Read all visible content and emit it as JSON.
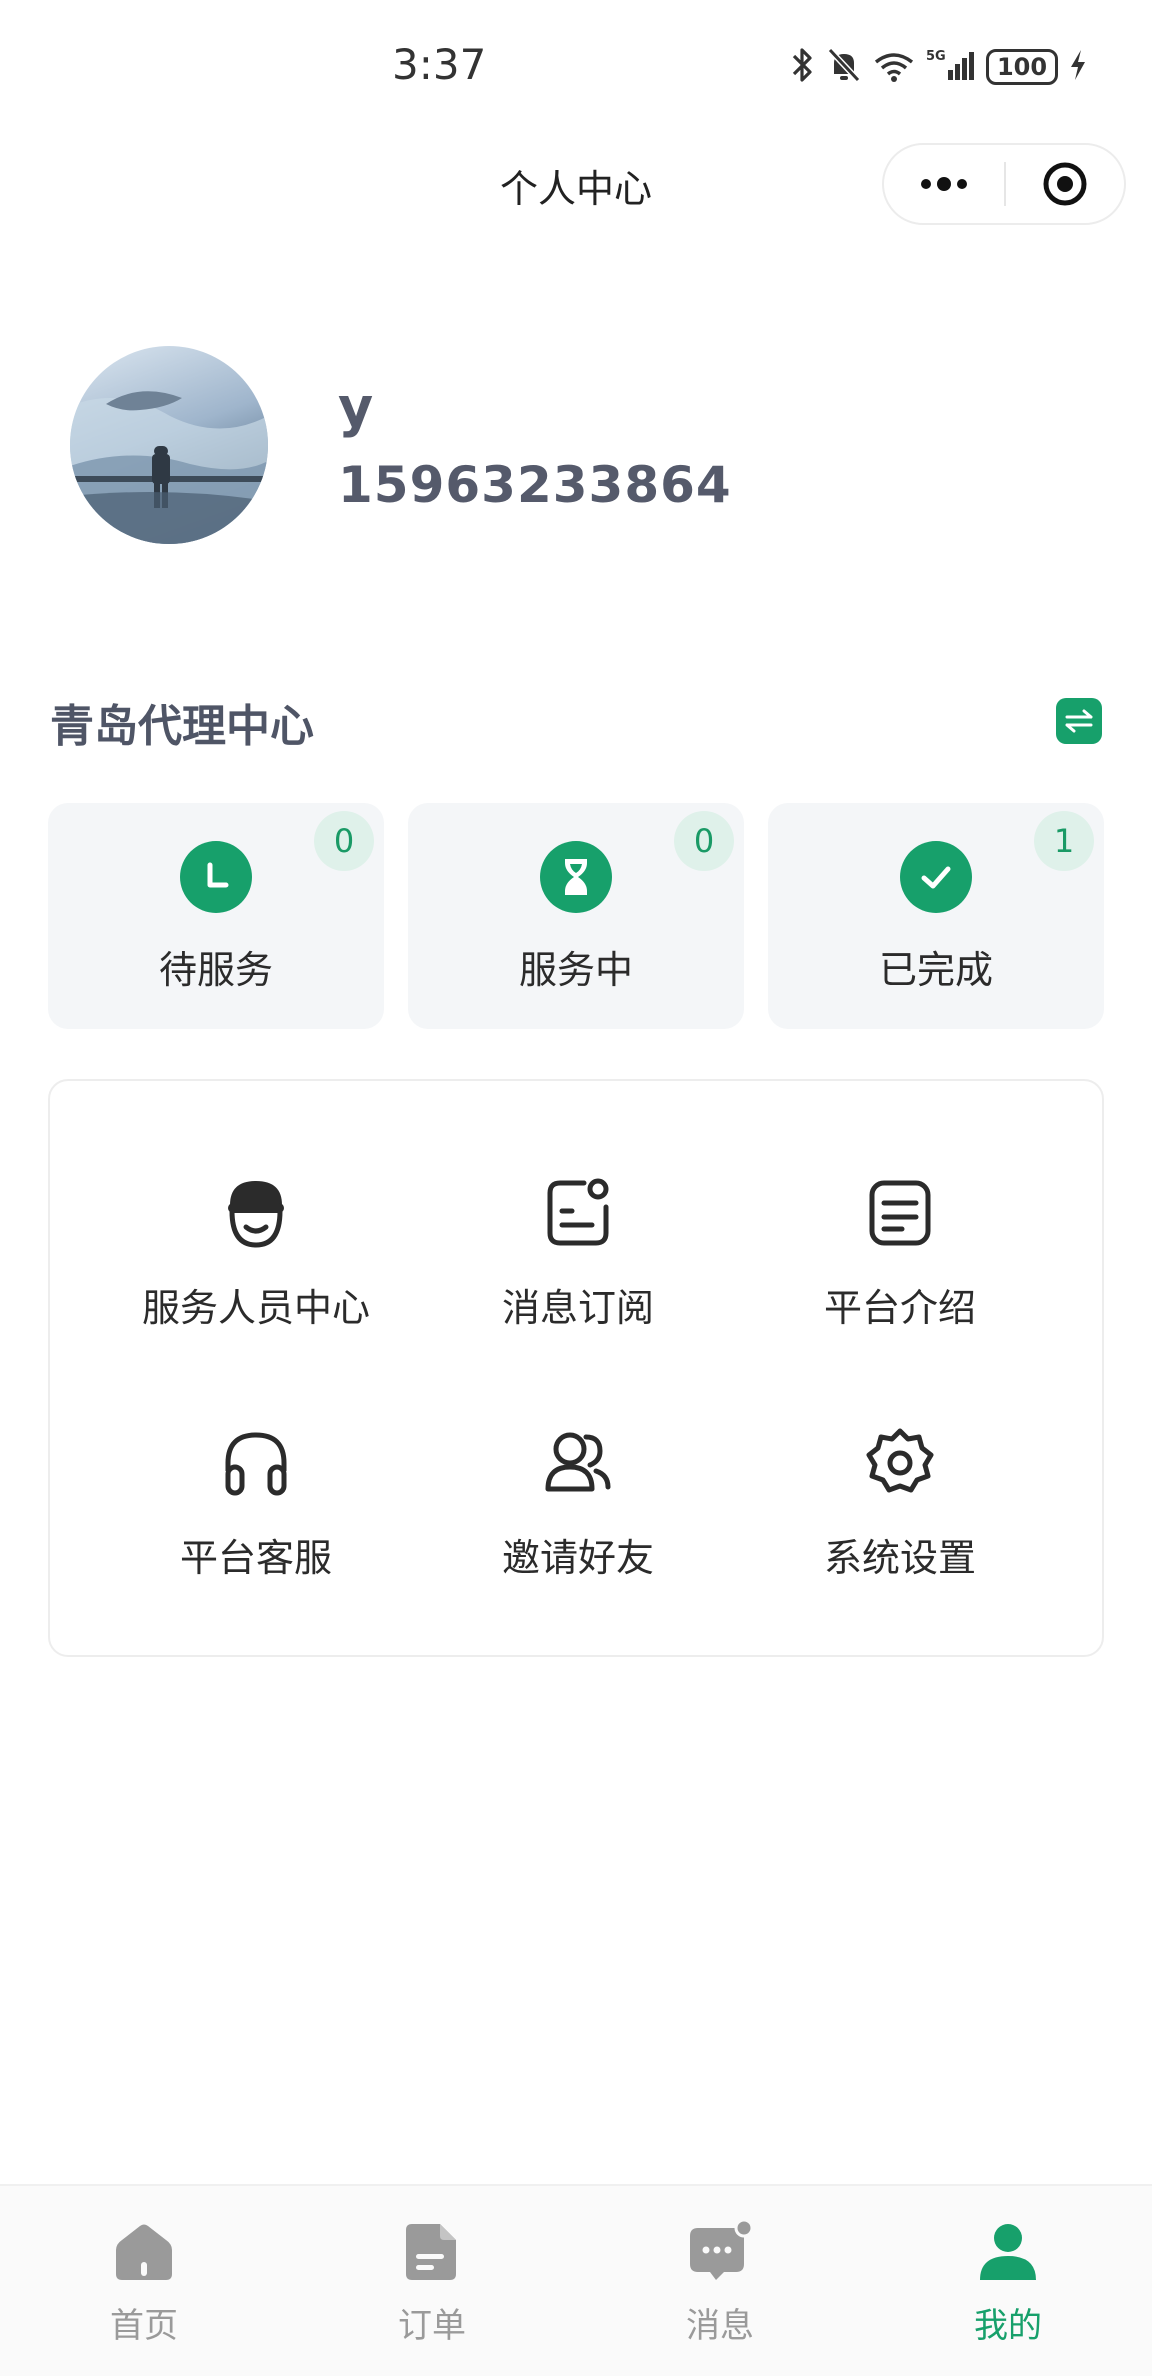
{
  "status_bar": {
    "time": "3:37",
    "battery": "100",
    "network": "5G"
  },
  "nav": {
    "title": "个人中心"
  },
  "profile": {
    "name": "y",
    "phone": "15963233864"
  },
  "center": {
    "title": "青岛代理中心"
  },
  "stats": [
    {
      "label": "待服务",
      "count": "0",
      "icon": "clock-icon"
    },
    {
      "label": "服务中",
      "count": "0",
      "icon": "hourglass-icon"
    },
    {
      "label": "已完成",
      "count": "1",
      "icon": "check-icon"
    }
  ],
  "menu": [
    {
      "label": "服务人员中心",
      "icon": "worker-icon"
    },
    {
      "label": "消息订阅",
      "icon": "subscribe-icon"
    },
    {
      "label": "平台介绍",
      "icon": "document-icon"
    },
    {
      "label": "平台客服",
      "icon": "headset-icon"
    },
    {
      "label": "邀请好友",
      "icon": "friends-icon"
    },
    {
      "label": "系统设置",
      "icon": "settings-icon"
    }
  ],
  "tabs": [
    {
      "label": "首页",
      "icon": "home-icon",
      "active": false
    },
    {
      "label": "订单",
      "icon": "order-icon",
      "active": false
    },
    {
      "label": "消息",
      "icon": "message-icon",
      "active": false
    },
    {
      "label": "我的",
      "icon": "user-icon",
      "active": true
    }
  ],
  "colors": {
    "accent": "#17a06b",
    "badge_bg": "#dff1ea",
    "card_bg": "#f4f6f8",
    "tab_inactive": "#9a9a9a"
  }
}
